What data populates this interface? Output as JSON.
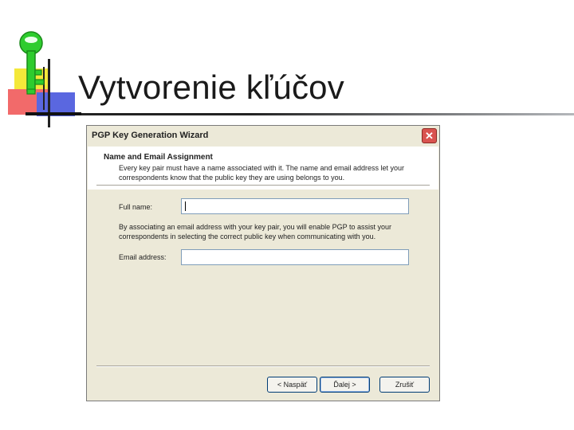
{
  "slide": {
    "title": "Vytvorenie kľúčov"
  },
  "dialog": {
    "title": "PGP Key Generation Wizard",
    "close_glyph": "✕",
    "section_title": "Name and Email Assignment",
    "section_description": "Every key pair must have a name associated with it. The name and email address let your correspondents know that the public key they are using belongs to you.",
    "full_name_label": "Full name:",
    "full_name_value": "",
    "email_note": "By associating an email address with your key pair, you will enable PGP to assist your correspondents in selecting the correct public key when communicating with you.",
    "email_label": "Email address:",
    "email_value": "",
    "buttons": {
      "back": "< Naspäť",
      "next": "Ďalej >",
      "cancel": "Zrušiť"
    }
  },
  "colors": {
    "dialog_bg": "#ece9d8",
    "close_button": "#d9534f",
    "key_icon": "#2ecc2e"
  },
  "icons": [
    "key-icon",
    "close-icon"
  ]
}
